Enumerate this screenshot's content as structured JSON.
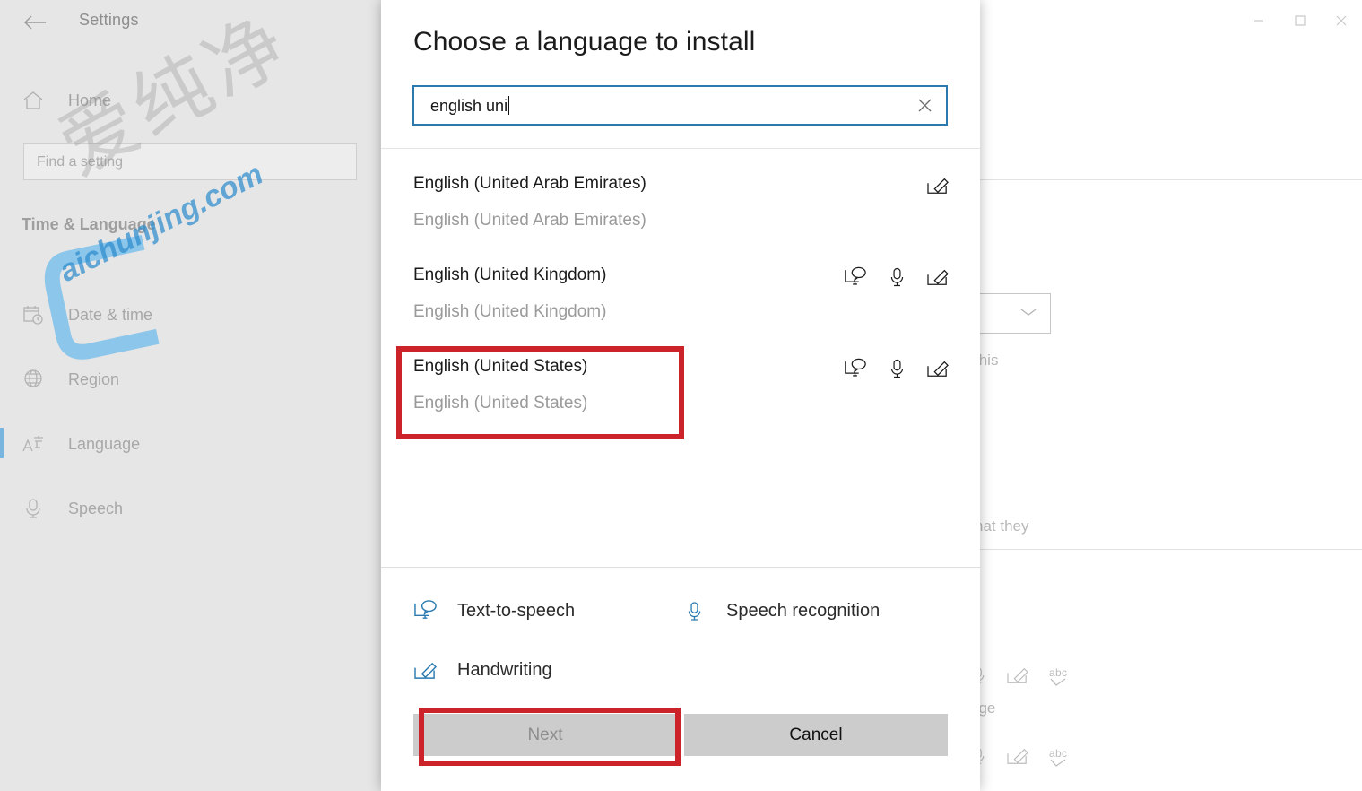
{
  "window": {
    "title": "Settings",
    "back_icon": "back-arrow-icon",
    "controls": [
      {
        "name": "minimize",
        "glyph": "—"
      },
      {
        "name": "maximize",
        "glyph": "□"
      },
      {
        "name": "close",
        "glyph": "✕"
      }
    ]
  },
  "sidebar": {
    "home_label": "Home",
    "search": {
      "placeholder": "Find a setting",
      "value": ""
    },
    "section_title": "Time & Language",
    "items": [
      {
        "label": "Date & time",
        "icon": "calendar-clock-icon",
        "selected": false
      },
      {
        "label": "Region",
        "icon": "globe-icon",
        "selected": false
      },
      {
        "label": "Language",
        "icon": "language-icon",
        "selected": true
      },
      {
        "label": "Speech",
        "icon": "microphone-icon",
        "selected": false
      }
    ]
  },
  "watermark": {
    "chinese": "爱纯净",
    "url": "aichunjing.com",
    "color": "#2d8ccd"
  },
  "background_content": {
    "fragment_this": "this",
    "fragment_hat_they": "hat they",
    "fragment_age": "age",
    "dropdown_icon": "chevron-down-icon",
    "feature_icons": [
      "microphone-icon",
      "handwriting-icon",
      "spellcheck-abc-icon"
    ]
  },
  "dialog": {
    "title": "Choose a language to install",
    "search": {
      "value": "english uni",
      "placeholder": "",
      "clear_icon": "close-x-icon"
    },
    "languages": [
      {
        "primary": "English (United Arab Emirates)",
        "secondary": "English (United Arab Emirates)",
        "icons": [
          "handwriting-icon"
        ],
        "highlighted": false
      },
      {
        "primary": "English (United Kingdom)",
        "secondary": "English (United Kingdom)",
        "icons": [
          "text-to-speech-icon",
          "microphone-icon",
          "handwriting-icon"
        ],
        "highlighted": false
      },
      {
        "primary": "English (United States)",
        "secondary": "English (United States)",
        "icons": [
          "text-to-speech-icon",
          "microphone-icon",
          "handwriting-icon"
        ],
        "highlighted": true
      }
    ],
    "legend": [
      {
        "label": "Text-to-speech",
        "icon": "text-to-speech-icon"
      },
      {
        "label": "Speech recognition",
        "icon": "microphone-icon"
      },
      {
        "label": "Handwriting",
        "icon": "handwriting-icon"
      }
    ],
    "buttons": {
      "next": "Next",
      "cancel": "Cancel"
    }
  },
  "annotations": {
    "color": "#cc2229",
    "boxes": [
      "language-item-english-united-states",
      "next-button"
    ]
  }
}
